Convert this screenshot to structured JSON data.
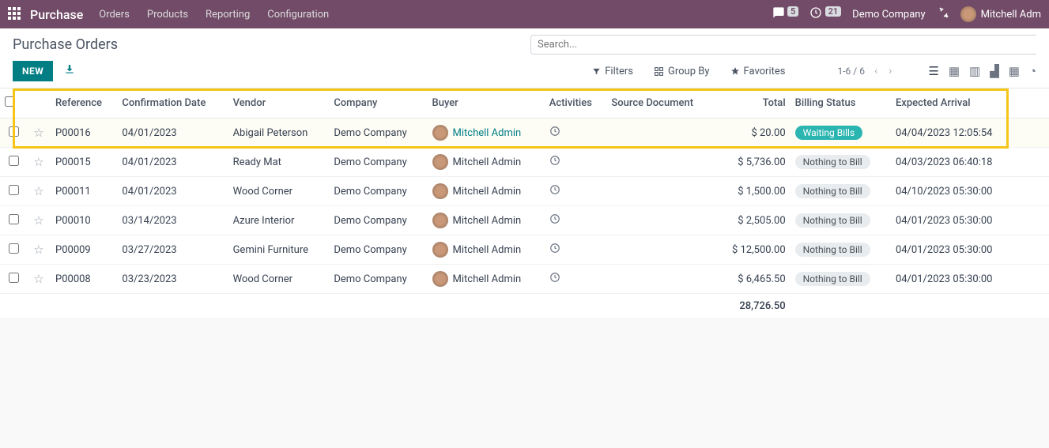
{
  "nav": {
    "brand": "Purchase",
    "items": [
      "Orders",
      "Products",
      "Reporting",
      "Configuration"
    ],
    "msg_count": "5",
    "act_count": "21",
    "company": "Demo Company",
    "user": "Mitchell Adm"
  },
  "page": {
    "title": "Purchase Orders",
    "new_btn": "NEW",
    "search_placeholder": "Search...",
    "filters": "Filters",
    "groupby": "Group By",
    "favorites": "Favorites",
    "pager": "1-6 / 6"
  },
  "cols": {
    "reference": "Reference",
    "confirmation": "Confirmation Date",
    "vendor": "Vendor",
    "company": "Company",
    "buyer": "Buyer",
    "activities": "Activities",
    "source": "Source Document",
    "total": "Total",
    "billing": "Billing Status",
    "expected": "Expected Arrival"
  },
  "rows": [
    {
      "ref": "P00016",
      "conf": "04/01/2023",
      "vendor": "Abigail Peterson",
      "company": "Demo Company",
      "buyer": "Mitchell Admin",
      "total": "$ 20.00",
      "bill": "Waiting Bills",
      "bill_cls": "bg-wait",
      "exp": "04/04/2023 12:05:54",
      "hl": true,
      "lnk": true
    },
    {
      "ref": "P00015",
      "conf": "04/01/2023",
      "vendor": "Ready Mat",
      "company": "Demo Company",
      "buyer": "Mitchell Admin",
      "total": "$ 5,736.00",
      "bill": "Nothing to Bill",
      "bill_cls": "bg-none",
      "exp": "04/03/2023 06:40:18"
    },
    {
      "ref": "P00011",
      "conf": "04/01/2023",
      "vendor": "Wood Corner",
      "company": "Demo Company",
      "buyer": "Mitchell Admin",
      "total": "$ 1,500.00",
      "bill": "Nothing to Bill",
      "bill_cls": "bg-none",
      "exp": "04/10/2023 05:30:00"
    },
    {
      "ref": "P00010",
      "conf": "03/14/2023",
      "vendor": "Azure Interior",
      "company": "Demo Company",
      "buyer": "Mitchell Admin",
      "total": "$ 2,505.00",
      "bill": "Nothing to Bill",
      "bill_cls": "bg-none",
      "exp": "04/01/2023 05:30:00"
    },
    {
      "ref": "P00009",
      "conf": "03/27/2023",
      "vendor": "Gemini Furniture",
      "company": "Demo Company",
      "buyer": "Mitchell Admin",
      "total": "$ 12,500.00",
      "bill": "Nothing to Bill",
      "bill_cls": "bg-none",
      "exp": "04/01/2023 05:30:00"
    },
    {
      "ref": "P00008",
      "conf": "03/23/2023",
      "vendor": "Wood Corner",
      "company": "Demo Company",
      "buyer": "Mitchell Admin",
      "total": "$ 6,465.50",
      "bill": "Nothing to Bill",
      "bill_cls": "bg-none",
      "exp": "04/01/2023 05:30:00"
    }
  ],
  "sum": "28,726.50"
}
